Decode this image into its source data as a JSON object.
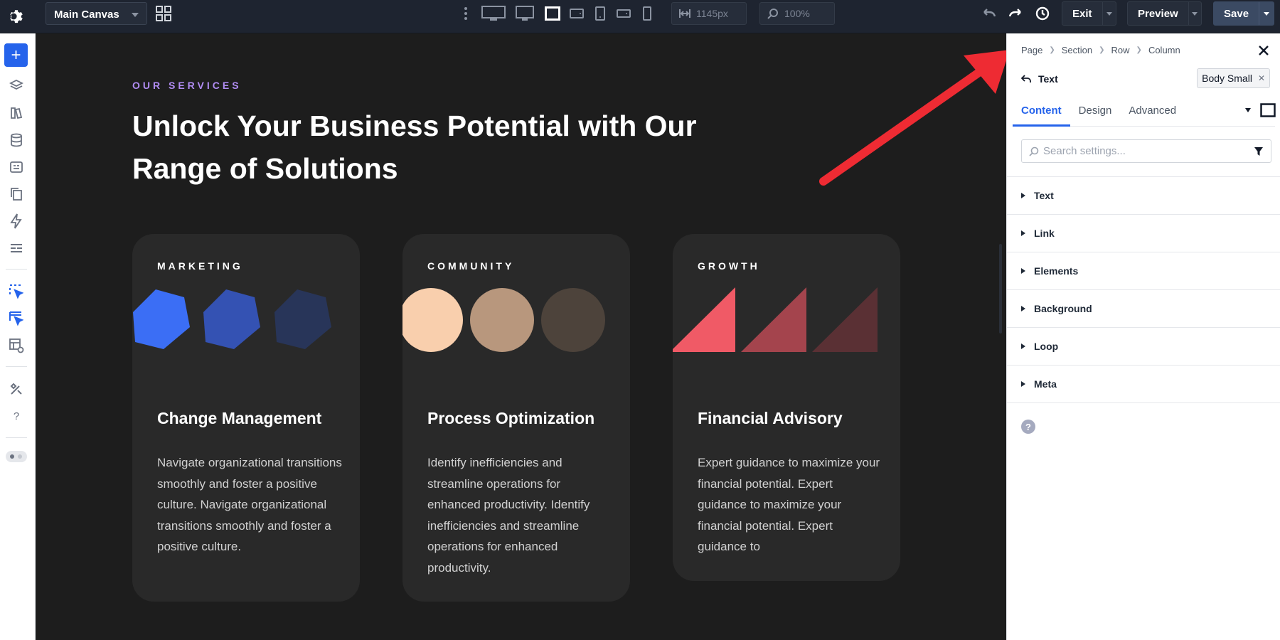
{
  "topbar": {
    "canvas_select": "Main Canvas",
    "width_value": "1145px",
    "zoom_value": "100%",
    "exit_label": "Exit",
    "preview_label": "Preview",
    "save_label": "Save",
    "devices": [
      "wide-desktop",
      "desktop",
      "laptop",
      "tablet-landscape",
      "tablet",
      "phone-landscape",
      "phone"
    ],
    "active_device": "laptop"
  },
  "leftrail": {
    "icons": [
      "add-icon",
      "layers-icon",
      "library-icon",
      "database-icon",
      "forms-icon",
      "pages-icon",
      "lightning-icon",
      "sections-icon",
      "select-icon",
      "multi-select-icon",
      "layout-settings-icon",
      "tools-icon",
      "help-icon",
      "toggle"
    ]
  },
  "page": {
    "eyebrow": "OUR SERVICES",
    "headline_line1": "Unlock Your Business Potential with Our",
    "headline_line2": "Range of Solutions",
    "cards": [
      {
        "label": "MARKETING",
        "title": "Change Management",
        "text": "Navigate organizational transitions smoothly and foster a positive culture. Navigate organizational transitions smoothly and foster a positive culture.",
        "shape": "hexagon",
        "colors": [
          "#3b6ef5",
          "#3452b3",
          "#283559"
        ]
      },
      {
        "label": "COMMUNITY",
        "title": "Process Optimization",
        "text": "Identify inefficiencies and streamline operations for enhanced productivity. Identify inefficiencies and streamline operations for enhanced productivity.",
        "shape": "circle",
        "colors": [
          "#f9cfad",
          "#b8977d",
          "#4d433b"
        ]
      },
      {
        "label": "GROWTH",
        "title": "Financial Advisory",
        "text": "Expert guidance to maximize your financial potential. Expert guidance to maximize your financial potential. Expert guidance to",
        "shape": "triangle",
        "colors": [
          "#f05a66",
          "#a4444d",
          "#5a3034"
        ]
      }
    ]
  },
  "panel": {
    "breadcrumb": [
      "Page",
      "Section",
      "Row",
      "Column"
    ],
    "element_name": "Text",
    "preset_label": "Body Small",
    "tabs": [
      "Content",
      "Design",
      "Advanced"
    ],
    "active_tab": "Content",
    "search_placeholder": "Search settings...",
    "sections": [
      "Text",
      "Link",
      "Elements",
      "Background",
      "Loop",
      "Meta"
    ],
    "help": "?"
  },
  "colors": {
    "accent": "#2563eb",
    "eyebrow": "#b08cf2",
    "annotation_arrow": "#ee2b33"
  }
}
